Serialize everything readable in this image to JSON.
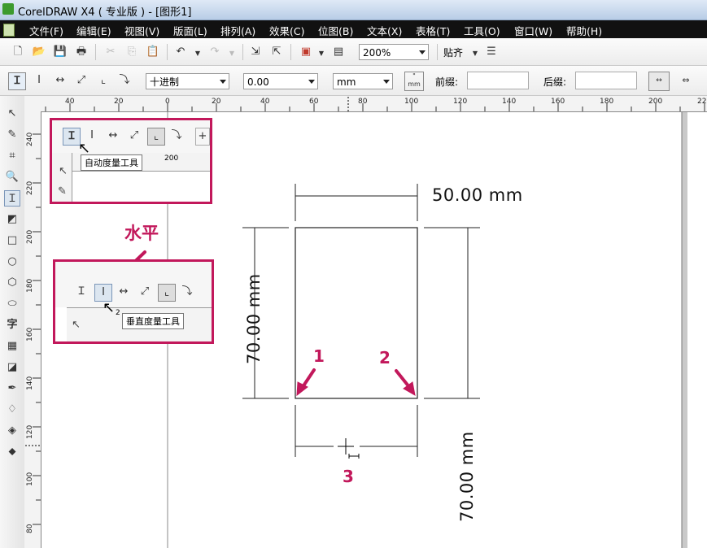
{
  "window": {
    "title": "CorelDRAW X4 ( 专业版 ) - [图形1]"
  },
  "menu": [
    "文件(F)",
    "编辑(E)",
    "视图(V)",
    "版面(L)",
    "排列(A)",
    "效果(C)",
    "位图(B)",
    "文本(X)",
    "表格(T)",
    "工具(O)",
    "窗口(W)",
    "帮助(H)"
  ],
  "toolbar1": {
    "zoom": "200%",
    "snap_label": "贴齐"
  },
  "toolbar2": {
    "units_format": "十进制",
    "precision": "0.00",
    "units": "mm",
    "prefix_label": "前缀:",
    "suffix_label": "后缀:",
    "prefix_value": "",
    "suffix_value": ""
  },
  "ruler": {
    "h_ticks": [
      "40",
      "20",
      "0",
      "20",
      "40",
      "60",
      "80",
      "100",
      "120",
      "140",
      "160",
      "180",
      "200",
      "22"
    ],
    "v_ticks": [
      "240",
      "220",
      "200",
      "180",
      "160",
      "140",
      "120",
      "100",
      "80"
    ]
  },
  "inset1": {
    "tooltip": "自动度量工具",
    "ruler_tick": "200"
  },
  "inset2": {
    "tooltip": "垂直度量工具",
    "ruler_tick": "2"
  },
  "annotations": {
    "horizontal_label": "水平",
    "marker1": "1",
    "marker2": "2",
    "marker3": "3"
  },
  "dimensions": {
    "top": "50.00 mm",
    "left": "70.00 mm",
    "right": "70.00 mm"
  },
  "colors": {
    "accent": "#c2185b",
    "menubar": "#111111",
    "titlebar": "#c9d9ee"
  }
}
